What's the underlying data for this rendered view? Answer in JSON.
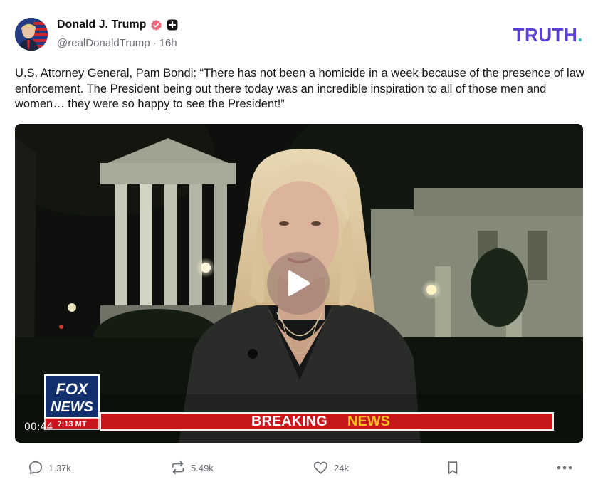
{
  "post": {
    "author_name": "Donald J. Trump",
    "handle": "@realDonaldTrump",
    "separator": "·",
    "time_ago": "16h",
    "text": "U.S. Attorney General, Pam Bondi: “There has not been a homicide in a week because of the presence of law enforcement. The President being out there today was an incredible inspiration to all of those men and women… they were so happy to see the President!”"
  },
  "brand": {
    "name": "TRUTH",
    "dot": ".",
    "color": "#5b3fd6",
    "dot_color": "#1fc9bd"
  },
  "video": {
    "duration": "00:44",
    "network_logo_top": "FOX",
    "network_logo_bottom": "NEWS",
    "time_bug": "7:13 MT",
    "banner_word1": "BREAKING",
    "banner_word2": "NEWS"
  },
  "actions": {
    "replies": "1.37k",
    "retruths": "5.49k",
    "likes": "24k"
  },
  "colors": {
    "verified_badge": "#e86a7a",
    "muted_text": "#6b6f76",
    "banner_red": "#c8161d",
    "banner_yellow": "#f4c21b"
  }
}
